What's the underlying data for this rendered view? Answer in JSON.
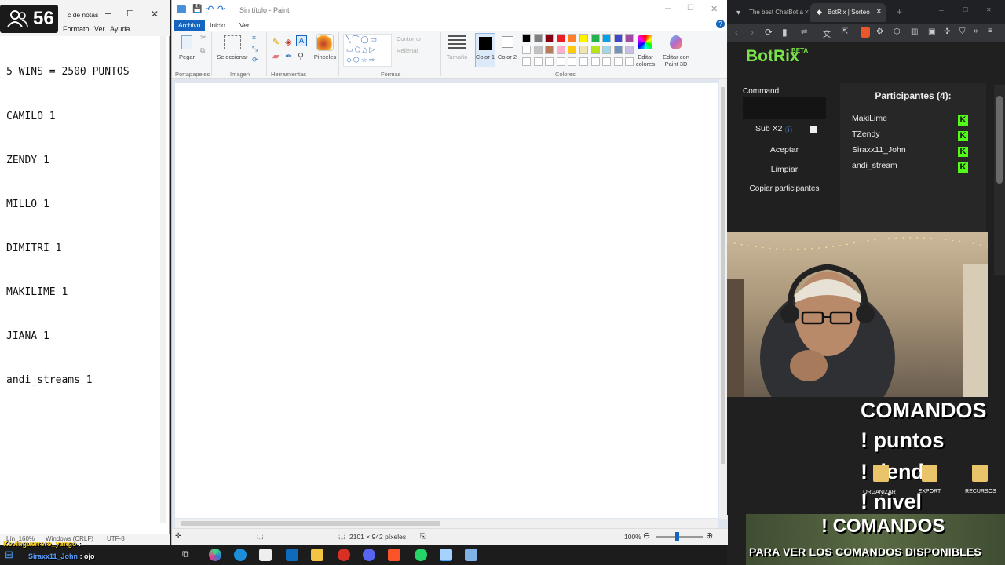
{
  "viewers": {
    "count": "56"
  },
  "notepad": {
    "title": "c de notas",
    "menu": [
      "Formato",
      "Ver",
      "Ayuda"
    ],
    "lines": [
      "5 WINS = 2500 PUNTOS",
      "CAMILO 1",
      "ZENDY 1",
      "MILLO 1",
      "DIMITRI 1",
      "MAKILIME 1",
      "JIANA 1",
      "andi_streams 1"
    ],
    "status": {
      "position": "Lín, 160%",
      "eol": "Windows (CRLF)",
      "encoding": "UTF-8"
    }
  },
  "paint": {
    "title": "Sin título - Paint",
    "tabs": [
      "Archivo",
      "Inicio",
      "Ver"
    ],
    "ribbon": {
      "paste": "Pegar",
      "select": "Seleccionar",
      "brushes": "Pinceles",
      "outline": "Contorno",
      "fill": "Rellenar",
      "size": "Tamaño",
      "color1": "Color 1",
      "color2": "Color 2",
      "edit_colors": "Editar colores",
      "edit_3d": "Editar con Paint 3D"
    },
    "groups": [
      "Portapapeles",
      "Imagen",
      "Herramientas",
      "Formas",
      "Colores"
    ],
    "palette": [
      "#000000",
      "#7f7f7f",
      "#880015",
      "#ed1c24",
      "#ff7f27",
      "#fff200",
      "#22b14c",
      "#00a2e8",
      "#3f48cc",
      "#a349a4",
      "#ffffff",
      "#c3c3c3",
      "#b97a57",
      "#ffaec9",
      "#ffc90e",
      "#efe4b0",
      "#b5e61d",
      "#99d9ea",
      "#7092be",
      "#c8bfe7"
    ],
    "status": {
      "dimensions": "2101 × 942 píxeles",
      "zoom": "100%"
    }
  },
  "browser": {
    "tabs": [
      "The best ChatBot a",
      "BotRix | Sorteo"
    ],
    "logo": "BotRix",
    "beta": "BETA",
    "command_label": "Command:",
    "sub_label": "Sub X2",
    "buttons": {
      "accept": "Aceptar",
      "clear": "Limpiar",
      "copy": "Copiar participantes"
    },
    "participants_title": "Participantes (4):",
    "participants": [
      "MakiLime",
      "TZendy",
      "Siraxx11_John",
      "andi_stream"
    ]
  },
  "overlay": {
    "commands_title": "COMANDOS",
    "cmd1": "! puntos",
    "cmd2": "! tienda",
    "cmd3": "! nivel",
    "banner_title": "! COMANDOS",
    "banner_sub": "PARA VER LOS COMANDOS DISPONIBLES",
    "folders": [
      "ORGANIZAR DISEÑOS",
      "EXPORT",
      "RECURSOS"
    ]
  },
  "chat": [
    {
      "user": "Kevinguerrero_yungo",
      "text": ":"
    },
    {
      "user": "Siraxx11_John",
      "text": ": ojo"
    }
  ],
  "colors": {
    "kick_green": "#53fc18",
    "botrix_green": "#7be14a",
    "paint_accent": "#1565c0"
  }
}
